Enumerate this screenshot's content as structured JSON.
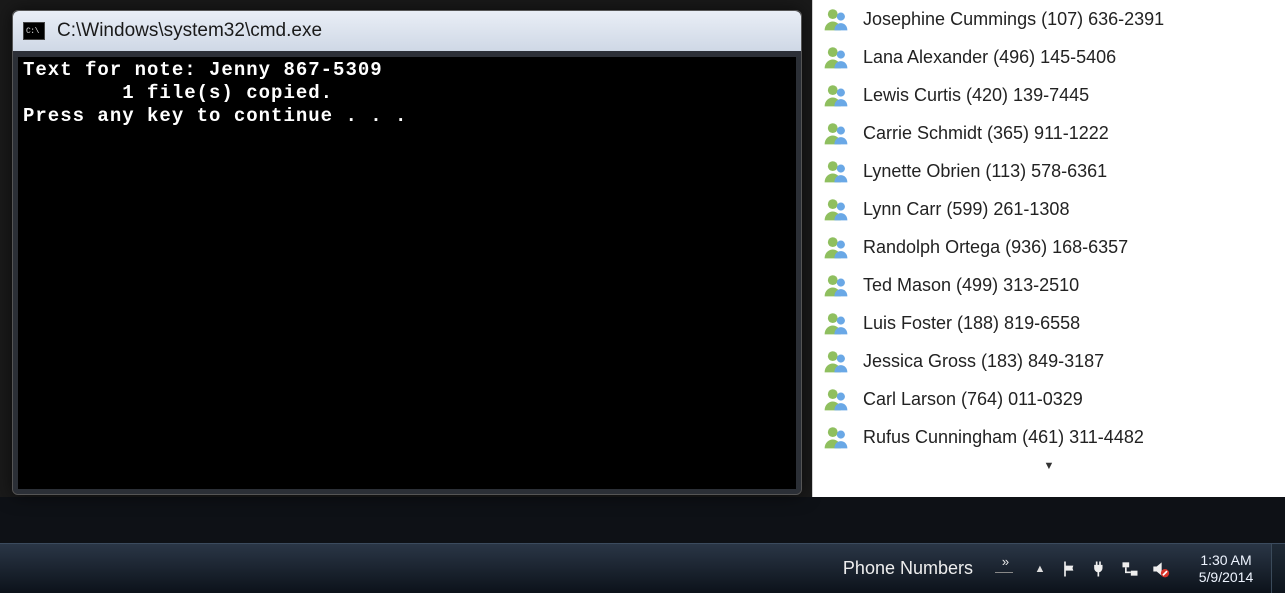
{
  "cmd": {
    "title": "C:\\Windows\\system32\\cmd.exe",
    "icon_label": "C:\\",
    "lines": [
      "Text for note: Jenny 867-5309",
      "        1 file(s) copied.",
      "Press any key to continue . . ."
    ]
  },
  "notes": {
    "items": [
      {
        "label": "Josephine Cummings (107) 636-2391"
      },
      {
        "label": "Lana Alexander (496) 145-5406"
      },
      {
        "label": "Lewis Curtis (420) 139-7445"
      },
      {
        "label": "Carrie Schmidt (365) 911-1222"
      },
      {
        "label": "Lynette Obrien (113) 578-6361"
      },
      {
        "label": "Lynn Carr (599) 261-1308"
      },
      {
        "label": "Randolph Ortega (936) 168-6357"
      },
      {
        "label": "Ted Mason (499) 313-2510"
      },
      {
        "label": "Luis Foster (188) 819-6558"
      },
      {
        "label": "Jessica Gross (183) 849-3187"
      },
      {
        "label": "Carl Larson (764) 011-0329"
      },
      {
        "label": "Rufus Cunningham (461) 311-4482"
      }
    ],
    "more_glyph": "▼"
  },
  "taskbar": {
    "button": "Phone Numbers",
    "overflow_glyph": "»",
    "tray_up_glyph": "▲",
    "clock": {
      "time": "1:30 AM",
      "date": "5/9/2014"
    }
  }
}
